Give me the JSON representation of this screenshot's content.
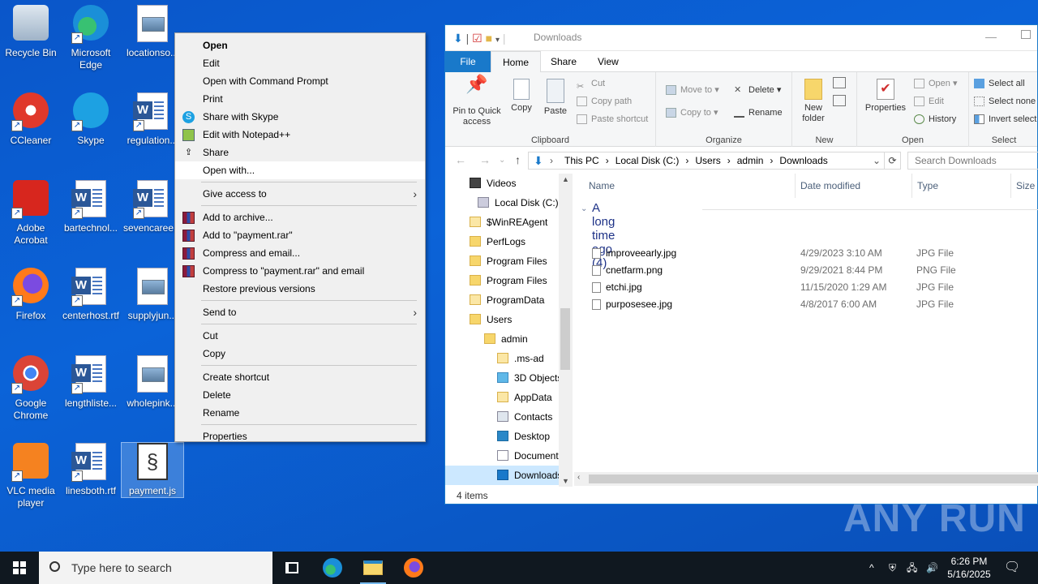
{
  "desktop": {
    "icons": [
      {
        "label": "Recycle Bin",
        "icon": "recycle-bin-icon"
      },
      {
        "label": "Microsoft Edge",
        "icon": "edge-icon"
      },
      {
        "label": "locationso...",
        "icon": "image-file-icon"
      },
      {
        "label": "CCleaner",
        "icon": "ccleaner-icon"
      },
      {
        "label": "Skype",
        "icon": "skype-icon"
      },
      {
        "label": "regulation...",
        "icon": "word-doc-icon"
      },
      {
        "label": "Adobe Acrobat",
        "icon": "acrobat-icon"
      },
      {
        "label": "bartechnol...",
        "icon": "word-doc-icon"
      },
      {
        "label": "sevencaree...",
        "icon": "word-doc-icon"
      },
      {
        "label": "Firefox",
        "icon": "firefox-icon"
      },
      {
        "label": "centerhost.rtf",
        "icon": "word-doc-icon"
      },
      {
        "label": "supplyjun...",
        "icon": "image-file-icon"
      },
      {
        "label": "Google Chrome",
        "icon": "chrome-icon"
      },
      {
        "label": "lengthliste...",
        "icon": "word-doc-icon"
      },
      {
        "label": "wholepink...",
        "icon": "image-file-icon"
      },
      {
        "label": "VLC media player",
        "icon": "vlc-icon"
      },
      {
        "label": "linesboth.rtf",
        "icon": "word-doc-icon"
      },
      {
        "label": "payment.js",
        "icon": "script-file-icon"
      }
    ]
  },
  "context_menu": {
    "items": [
      {
        "label": "Open",
        "bold": true
      },
      {
        "label": "Edit"
      },
      {
        "label": "Open with Command Prompt"
      },
      {
        "label": "Print"
      },
      {
        "label": "Share with Skype",
        "icon": "skype-icon"
      },
      {
        "label": "Edit with Notepad++",
        "icon": "notepadpp-icon"
      },
      {
        "label": "Share",
        "icon": "share-icon"
      },
      {
        "label": "Open with..."
      },
      {
        "label": "Give access to",
        "submenu": true
      },
      {
        "label": "Add to archive...",
        "icon": "winrar-icon"
      },
      {
        "label": "Add to \"payment.rar\"",
        "icon": "winrar-icon"
      },
      {
        "label": "Compress and email...",
        "icon": "winrar-icon"
      },
      {
        "label": "Compress to \"payment.rar\" and email",
        "icon": "winrar-icon"
      },
      {
        "label": "Restore previous versions"
      },
      {
        "label": "Send to",
        "submenu": true
      },
      {
        "label": "Cut"
      },
      {
        "label": "Copy"
      },
      {
        "label": "Create shortcut"
      },
      {
        "label": "Delete"
      },
      {
        "label": "Rename"
      },
      {
        "label": "Properties"
      }
    ],
    "submenu_arrow": "›"
  },
  "explorer": {
    "title": "Downloads",
    "tabs": {
      "file": "File",
      "home": "Home",
      "share": "Share",
      "view": "View"
    },
    "ribbon": {
      "pin": "Pin to Quick access",
      "copy": "Copy",
      "paste": "Paste",
      "cut": "Cut",
      "copy_path": "Copy path",
      "paste_shortcut": "Paste shortcut",
      "clipboard": "Clipboard",
      "move_to": "Move to",
      "copy_to": "Copy to",
      "delete": "Delete",
      "rename": "Rename",
      "organize": "Organize",
      "new_folder": "New folder",
      "new": "New",
      "properties": "Properties",
      "open": "Open",
      "edit": "Edit",
      "history": "History",
      "open_group": "Open",
      "select_all": "Select all",
      "select_none": "Select none",
      "invert_selection": "Invert select",
      "select": "Select"
    },
    "breadcrumb": [
      "This PC",
      "Local Disk (C:)",
      "Users",
      "admin",
      "Downloads"
    ],
    "breadcrumb_sep": "›",
    "search_placeholder": "Search Downloads",
    "nav_items": [
      {
        "label": "Videos",
        "indent": 1
      },
      {
        "label": "Local Disk (C:)",
        "indent": 0
      },
      {
        "label": "$WinREAgent",
        "indent": 1
      },
      {
        "label": "PerfLogs",
        "indent": 1
      },
      {
        "label": "Program Files",
        "indent": 1
      },
      {
        "label": "Program Files",
        "indent": 1
      },
      {
        "label": "ProgramData",
        "indent": 1
      },
      {
        "label": "Users",
        "indent": 1
      },
      {
        "label": "admin",
        "indent": 2
      },
      {
        "label": ".ms-ad",
        "indent": 3
      },
      {
        "label": "3D Objects",
        "indent": 3
      },
      {
        "label": "AppData",
        "indent": 3
      },
      {
        "label": "Contacts",
        "indent": 3
      },
      {
        "label": "Desktop",
        "indent": 3
      },
      {
        "label": "Documents",
        "indent": 3
      },
      {
        "label": "Downloads",
        "indent": 3
      }
    ],
    "columns": {
      "name": "Name",
      "date": "Date modified",
      "type": "Type",
      "size": "Size"
    },
    "group": "A long time ago (4)",
    "files": [
      {
        "name": "improveearly.jpg",
        "date": "4/29/2023 3:10 AM",
        "type": "JPG File"
      },
      {
        "name": "cnetfarm.png",
        "date": "9/29/2021 8:44 PM",
        "type": "PNG File"
      },
      {
        "name": "etchi.jpg",
        "date": "11/15/2020 1:29 AM",
        "type": "JPG File"
      },
      {
        "name": "purposesee.jpg",
        "date": "4/8/2017 6:00 AM",
        "type": "JPG File"
      }
    ],
    "status": "4 items"
  },
  "watermark": "ANY RUN",
  "taskbar": {
    "search_placeholder": "Type here to search",
    "time": "6:26 PM",
    "date": "5/16/2025"
  }
}
